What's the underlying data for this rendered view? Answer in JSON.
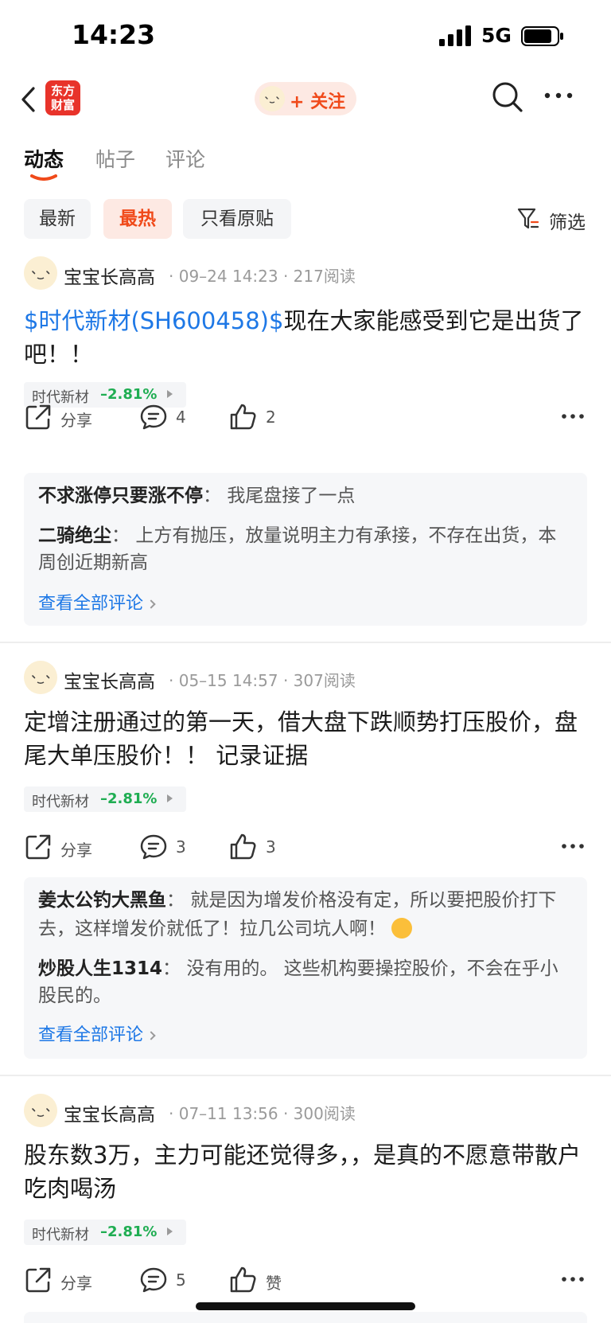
{
  "status_bar": {
    "time": "14:23",
    "network": "5G"
  },
  "nav": {
    "logo_line1": "东方",
    "logo_line2": "财富",
    "follow_label": "+ 关注"
  },
  "tabs": [
    {
      "label": "动态",
      "active": true
    },
    {
      "label": "帖子",
      "active": false
    },
    {
      "label": "评论",
      "active": false
    }
  ],
  "filters": {
    "chips": [
      {
        "label": "最新",
        "active": false
      },
      {
        "label": "最热",
        "active": true
      },
      {
        "label": "只看原贴",
        "active": false
      }
    ],
    "filter_label": "筛选"
  },
  "posts": [
    {
      "author": "宝宝长高高",
      "meta": "· 09–24 14:23 · 217阅读",
      "cashtag": "$时代新材(SH600458)$",
      "body": "现在大家能感受到它是出货了吧！！",
      "stock": {
        "name": "时代新材",
        "change": "–2.81%"
      },
      "share_label": "分享",
      "comment_count": "4",
      "like_count": "2",
      "comments": [
        {
          "user": "不求涨停只要涨不停",
          "sep": "：",
          "text": "我尾盘接了一点"
        },
        {
          "user": "二骑绝尘",
          "sep": "：",
          "text": "上方有抛压，放量说明主力有承接，不存在出货，本周创近期新高"
        }
      ],
      "view_all": "查看全部评论"
    },
    {
      "author": "宝宝长高高",
      "meta": "· 05–15 14:57 · 307阅读",
      "body": "定增注册通过的第一天，借大盘下跌顺势打压股价，盘尾大单压股价！！ 记录证据",
      "stock": {
        "name": "时代新材",
        "change": "–2.81%"
      },
      "share_label": "分享",
      "comment_count": "3",
      "like_count": "3",
      "comments": [
        {
          "user": "姜太公钓大黑鱼",
          "sep": "：",
          "text": "就是因为增发价格没有定，所以要把股价打下去，这样增发价就低了！拉几公司坑人啊！"
        },
        {
          "user": "炒股人生1314",
          "sep": "：",
          "text": "没有用的。  这些机构要操控股价，不会在乎小股民的。"
        }
      ],
      "view_all": "查看全部评论"
    },
    {
      "author": "宝宝长高高",
      "meta": "· 07–11 13:56 · 300阅读",
      "body": "股东数3万，主力可能还觉得多，，是真的不愿意带散户吃肉喝汤",
      "stock": {
        "name": "时代新材",
        "change": "–2.81%"
      },
      "share_label": "分享",
      "comment_count": "5",
      "like_label": "赞"
    }
  ]
}
